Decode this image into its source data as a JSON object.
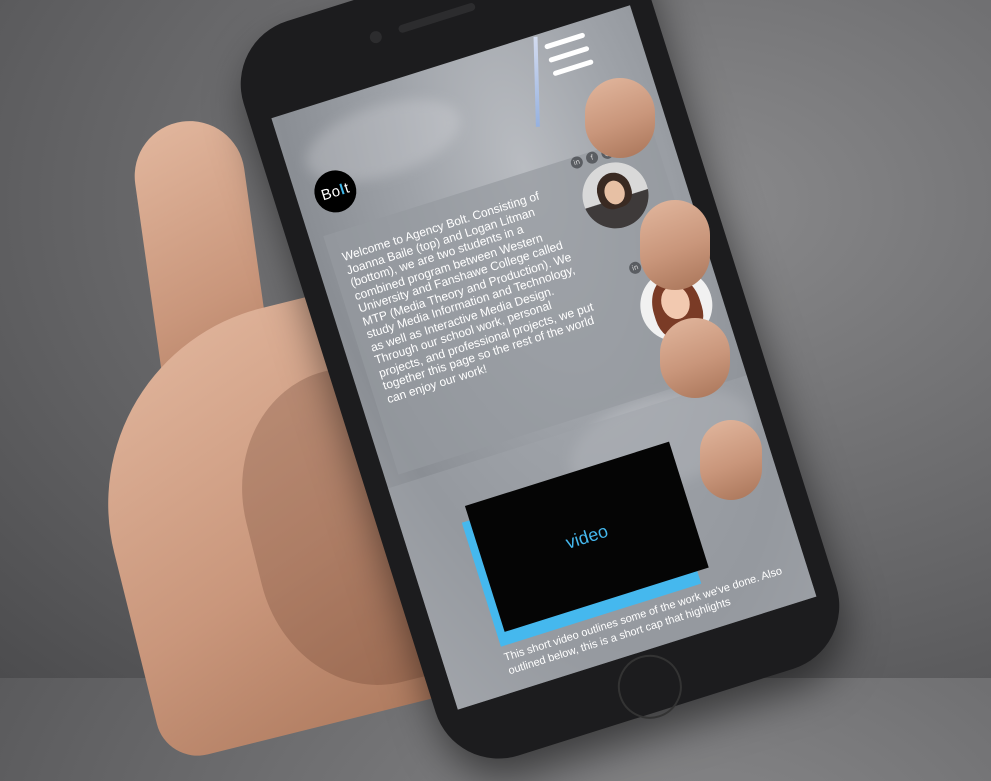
{
  "site": {
    "logo_text": "Bo",
    "logo_mark": "l",
    "logo_tail": "t"
  },
  "nav": {
    "menu_icon": "hamburger-menu-icon"
  },
  "intro": {
    "text": "Welcome to Agency Bolt. Consisting of Joanna Baile (top) and Logan Litman (bottom), we are two students in a combined program between Western University and Fanshawe College called MTP (Media Theory and Production). We study Media Information and Technology, as well as Interactive Media Design. Through our school work, personal projects, and professional projects, we put together this page so the rest of the world can enjoy our work!"
  },
  "social": {
    "icons": [
      "in",
      "f",
      "@"
    ]
  },
  "video": {
    "label": "video",
    "caption": "This short video outlines some of the work we've done. Also outlined below, this is a short cap that highlights"
  },
  "colors": {
    "accent": "#45b8ee",
    "panel": "#969aa0",
    "phone": "#1c1c1e"
  }
}
